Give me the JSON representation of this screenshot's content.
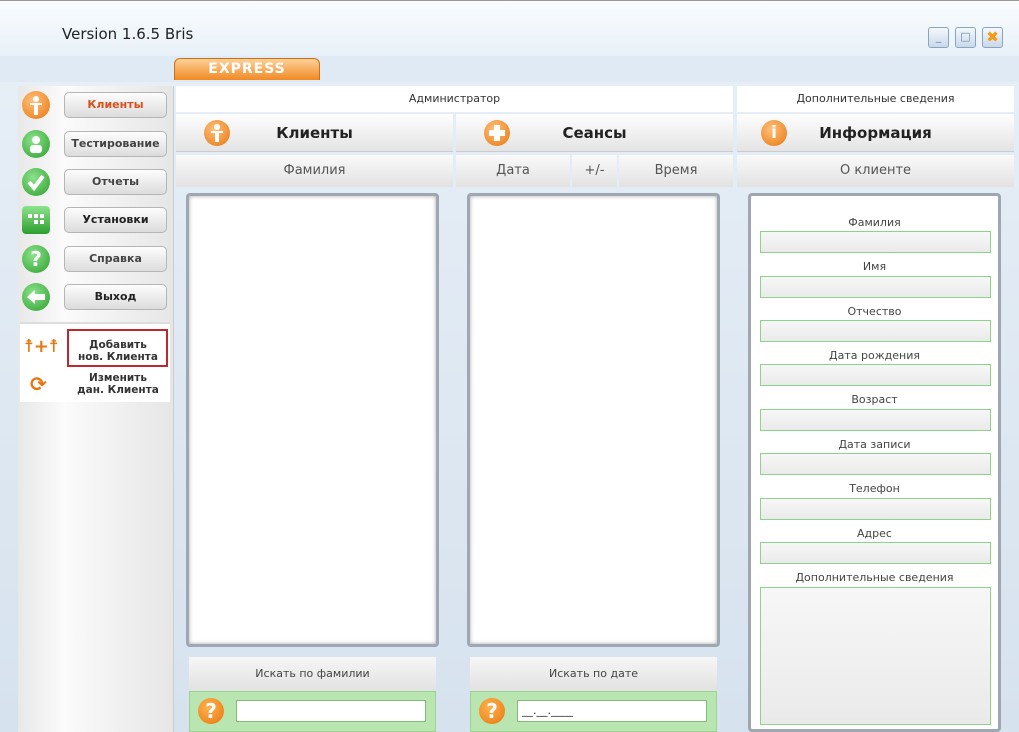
{
  "window": {
    "version": "Version 1.6.5 Bris",
    "minimize": "_",
    "maximize": "□",
    "close": "✖"
  },
  "tab": {
    "express": "EXPRESS"
  },
  "nav": {
    "items": [
      {
        "label": "Клиенты",
        "icon": "person-icon",
        "color": "#f08a24"
      },
      {
        "label": "Тестирование",
        "icon": "user-test-icon",
        "color": "#3db53d"
      },
      {
        "label": "Отчеты",
        "icon": "checkmark-icon",
        "color": "#3db53d"
      },
      {
        "label": "Установки",
        "icon": "settings-grid-icon",
        "color": "#3db53d"
      },
      {
        "label": "Справка",
        "icon": "help-icon",
        "color": "#3db53d"
      },
      {
        "label": "Выход",
        "icon": "exit-arrow-icon",
        "color": "#3db53d"
      }
    ]
  },
  "sub": {
    "add": "Добавить\nнов. Клиента",
    "edit": "Изменить\nдан. Клиента"
  },
  "header": {
    "admin": "Администратор",
    "extra": "Дополнительные сведения"
  },
  "sections": {
    "clients": "Клиенты",
    "sessions": "Сеансы",
    "info": "Информация"
  },
  "columns": {
    "surname": "Фамилия",
    "date": "Дата",
    "plusminus": "+/-",
    "time": "Время",
    "about": "О клиенте"
  },
  "search": {
    "by_surname": "Искать по фамилии",
    "by_date": "Искать по дате",
    "date_placeholder": "__.__.____"
  },
  "fields": [
    "Фамилия",
    "Имя",
    "Отчество",
    "Дата рождения",
    "Возраст",
    "Дата записи",
    "Телефон",
    "Адрес",
    "Дополнительные сведения"
  ]
}
